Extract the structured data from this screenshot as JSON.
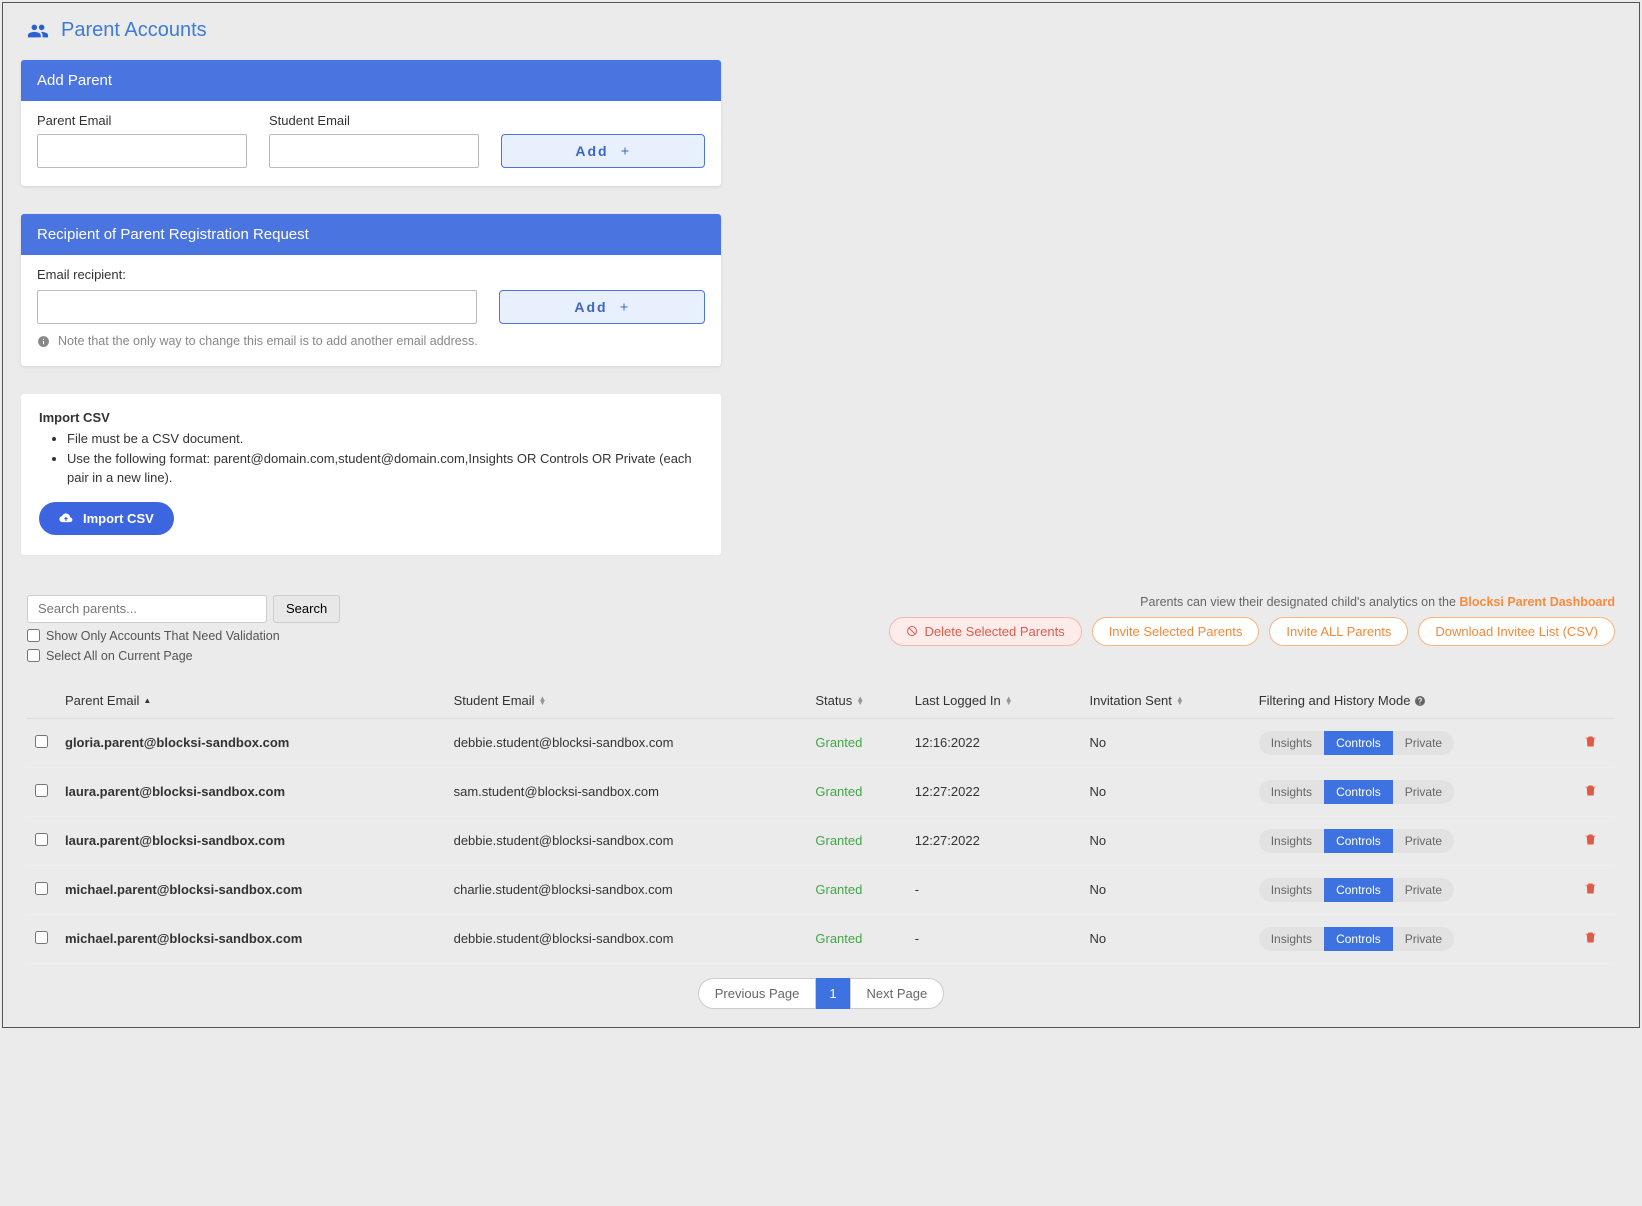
{
  "page": {
    "title": "Parent Accounts"
  },
  "addParent": {
    "header": "Add Parent",
    "parentEmailLabel": "Parent Email",
    "studentEmailLabel": "Student Email",
    "addBtn": "Add"
  },
  "recipient": {
    "header": "Recipient of Parent Registration Request",
    "emailLabel": "Email recipient:",
    "addBtn": "Add",
    "note": "Note that the only way to change this email is to add another email address."
  },
  "importCsv": {
    "title": "Import CSV",
    "bullets": [
      "File must be a CSV document.",
      "Use the following format: parent@domain.com,student@domain.com,Insights OR Controls OR Private (each pair in a new line)."
    ],
    "button": "Import CSV"
  },
  "tableArea": {
    "searchPlaceholder": "Search parents...",
    "searchBtn": "Search",
    "infoPrefix": "Parents can view their designated child's analytics on the ",
    "infoLink": "Blocksi Parent Dashboard",
    "deleteBtn": "Delete Selected Parents",
    "inviteSelectedBtn": "Invite Selected Parents",
    "inviteAllBtn": "Invite ALL Parents",
    "downloadBtn": "Download Invitee List (CSV)",
    "showOnlyValidation": "Show Only Accounts That Need Validation",
    "selectAll": "Select All on Current Page",
    "columns": {
      "parentEmail": "Parent Email",
      "studentEmail": "Student Email",
      "status": "Status",
      "lastLogged": "Last Logged In",
      "invitationSent": "Invitation Sent",
      "filtering": "Filtering and History Mode"
    },
    "modeLabels": {
      "insights": "Insights",
      "controls": "Controls",
      "private": "Private"
    },
    "rows": [
      {
        "parent": "gloria.parent@blocksi-sandbox.com",
        "student": "debbie.student@blocksi-sandbox.com",
        "status": "Granted",
        "lastLogged": "12:16:2022",
        "invitation": "No",
        "mode": "Controls"
      },
      {
        "parent": "laura.parent@blocksi-sandbox.com",
        "student": "sam.student@blocksi-sandbox.com",
        "status": "Granted",
        "lastLogged": "12:27:2022",
        "invitation": "No",
        "mode": "Controls"
      },
      {
        "parent": "laura.parent@blocksi-sandbox.com",
        "student": "debbie.student@blocksi-sandbox.com",
        "status": "Granted",
        "lastLogged": "12:27:2022",
        "invitation": "No",
        "mode": "Controls"
      },
      {
        "parent": "michael.parent@blocksi-sandbox.com",
        "student": "charlie.student@blocksi-sandbox.com",
        "status": "Granted",
        "lastLogged": "-",
        "invitation": "No",
        "mode": "Controls"
      },
      {
        "parent": "michael.parent@blocksi-sandbox.com",
        "student": "debbie.student@blocksi-sandbox.com",
        "status": "Granted",
        "lastLogged": "-",
        "invitation": "No",
        "mode": "Controls"
      }
    ],
    "pagination": {
      "prev": "Previous Page",
      "current": "1",
      "next": "Next Page"
    }
  }
}
